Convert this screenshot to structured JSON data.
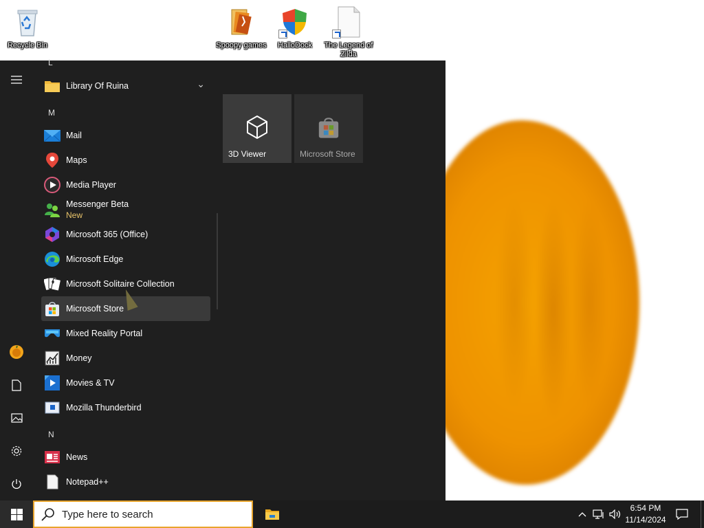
{
  "desktop": {
    "icons": [
      {
        "label": "Recycle Bin",
        "icon": "recycle-bin-icon"
      },
      {
        "label": "Spoopy games",
        "icon": "folder-icon"
      },
      {
        "label": "HalloDock",
        "icon": "shield-icon"
      },
      {
        "label": "The Legend of Zilda",
        "icon": "file-icon"
      }
    ]
  },
  "start_menu": {
    "rail": [
      {
        "name": "hamburger-icon"
      },
      {
        "name": "user-avatar"
      },
      {
        "name": "documents-icon"
      },
      {
        "name": "pictures-icon"
      },
      {
        "name": "settings-gear-icon"
      },
      {
        "name": "power-icon"
      }
    ],
    "letters": {
      "l": "L",
      "m": "M",
      "n": "N"
    },
    "apps": [
      {
        "label": "Library Of Ruina",
        "icon": "folder-icon",
        "expand": "⌄"
      },
      {
        "label": "Mail",
        "icon": "mail-icon"
      },
      {
        "label": "Maps",
        "icon": "maps-pin-icon"
      },
      {
        "label": "Media Player",
        "icon": "media-player-icon"
      },
      {
        "label": "Messenger Beta",
        "sub": "New",
        "icon": "messenger-icon"
      },
      {
        "label": "Microsoft 365 (Office)",
        "icon": "office-icon"
      },
      {
        "label": "Microsoft Edge",
        "icon": "edge-icon"
      },
      {
        "label": "Microsoft Solitaire Collection",
        "icon": "solitaire-icon"
      },
      {
        "label": "Microsoft Store",
        "icon": "store-icon"
      },
      {
        "label": "Mixed Reality Portal",
        "icon": "mixed-reality-icon"
      },
      {
        "label": "Money",
        "icon": "money-chart-icon"
      },
      {
        "label": "Movies & TV",
        "icon": "movies-tv-icon"
      },
      {
        "label": "Mozilla Thunderbird",
        "icon": "thunderbird-icon"
      },
      {
        "label": "News",
        "icon": "news-icon"
      },
      {
        "label": "Notepad++",
        "icon": "notepad-icon"
      }
    ],
    "tiles": [
      {
        "label": "3D Viewer",
        "icon": "cube-icon"
      },
      {
        "label": "Microsoft Store",
        "icon": "store-icon"
      }
    ]
  },
  "taskbar": {
    "search_placeholder": "Type here to search",
    "time": "6:54 PM",
    "date": "11/14/2024",
    "tray_icons": [
      "chevron-up-icon",
      "network-icon",
      "volume-icon"
    ],
    "notification_icon": "notification-icon"
  },
  "colors": {
    "start_bg": "#1f1f1f",
    "taskbar_bg": "#1c1c1c",
    "search_border": "#e8a42c",
    "accent_new": "#e9c46a",
    "pumpkin": "#f5a200"
  }
}
